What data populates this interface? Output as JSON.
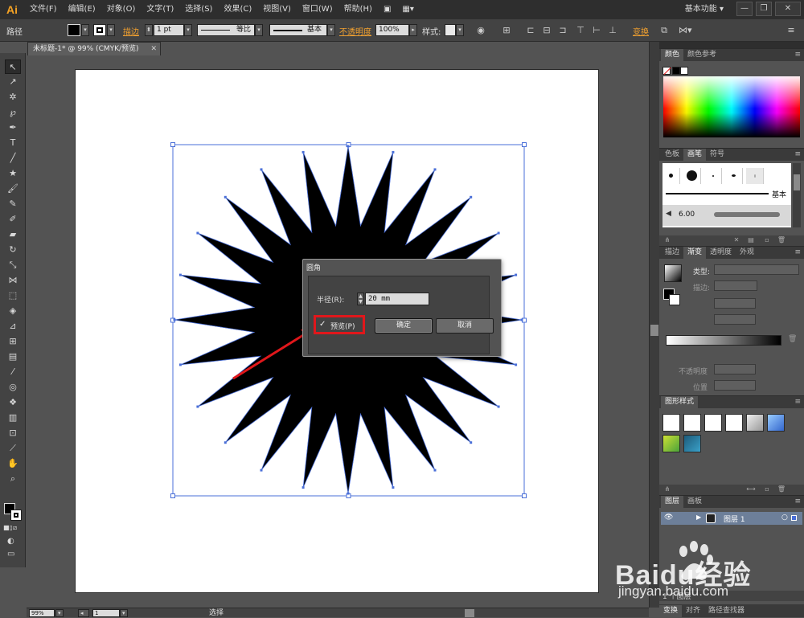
{
  "app": {
    "logo": "Ai",
    "workspace": "基本功能"
  },
  "menu": [
    "文件(F)",
    "编辑(E)",
    "对象(O)",
    "文字(T)",
    "选择(S)",
    "效果(C)",
    "视图(V)",
    "窗口(W)",
    "帮助(H)"
  ],
  "control": {
    "object_type": "路径",
    "stroke_label": "描边",
    "stroke_weight": "1 pt",
    "profile": "等比",
    "brush": "基本",
    "opacity_label": "不透明度",
    "opacity_value": "100%",
    "style_label": "样式:",
    "transform_label": "变换"
  },
  "document": {
    "tab_title": "未标题-1* @ 99% (CMYK/预览)"
  },
  "dialog": {
    "title": "圆角",
    "radius_label": "半径(R):",
    "radius_value": "20 mm",
    "preview_label": "预览(P)",
    "preview_checked": true,
    "ok_label": "确定",
    "cancel_label": "取消"
  },
  "panels": {
    "color_tabs": [
      "颜色",
      "颜色参考"
    ],
    "brush_tabs": [
      "色板",
      "画笔",
      "符号"
    ],
    "brush_basic": "基本",
    "brush_size": "6.00",
    "gradient_tabs": [
      "描边",
      "渐变",
      "透明度",
      "外观"
    ],
    "gradient_type_label": "类型:",
    "gradient_stroke_label": "描边:",
    "gradient_opacity_label": "不透明度",
    "gradient_location_label": "位置",
    "graphic_styles_tab": "图形样式",
    "layers_tabs": [
      "图层",
      "画板"
    ],
    "layer_name": "图层 1",
    "layers_count": "1 个图层",
    "bottom_tabs": [
      "变换",
      "对齐",
      "路径查找器"
    ]
  },
  "status": {
    "zoom": "99%",
    "page": "1",
    "mode": "选择"
  },
  "watermark": {
    "brand": "Baidu经验",
    "url": "jingyan.baidu.com"
  },
  "colors": {
    "accent_orange": "#f0a030",
    "highlight_red": "#e0171b",
    "selection_blue": "#4a6fd8"
  }
}
